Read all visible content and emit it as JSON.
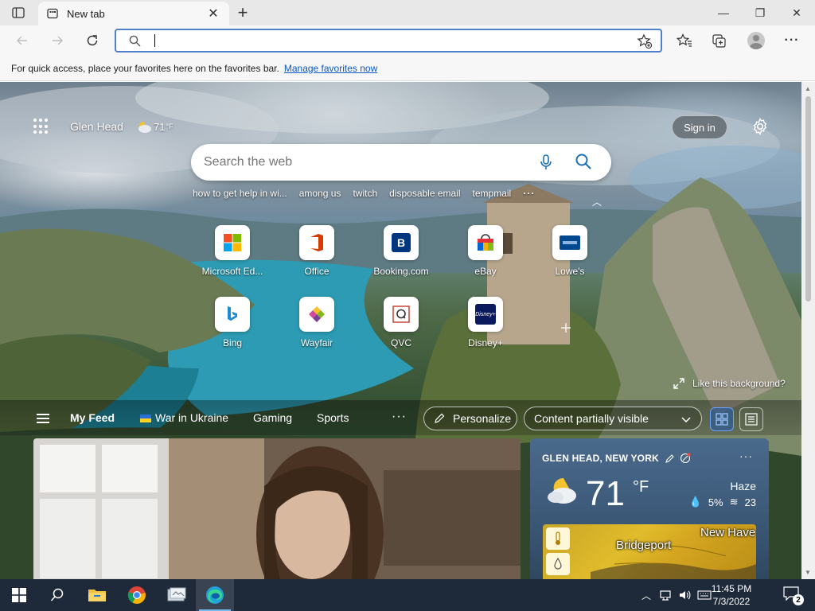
{
  "browser": {
    "tab": {
      "title": "New tab",
      "close_glyph": "✕"
    },
    "new_tab_glyph": "+",
    "window_controls": {
      "minimize": "—",
      "maximize": "❐",
      "close": "✕"
    },
    "address": {
      "value": "",
      "placeholder": ""
    },
    "favorites_bar": {
      "message": "For quick access, place your favorites here on the favorites bar.",
      "link": "Manage favorites now"
    }
  },
  "newtab": {
    "location": "Glen Head",
    "weather_mini": {
      "temp": "71",
      "unit": "°F"
    },
    "sign_in": "Sign in",
    "search": {
      "placeholder": "Search the web"
    },
    "trending": [
      "how to get help in wi...",
      "among us",
      "twitch",
      "disposable email",
      "tempmail"
    ],
    "trending_more": "···",
    "quick_links": [
      {
        "label": "Microsoft Ed...",
        "icon": "microsoft-icon"
      },
      {
        "label": "Office",
        "icon": "office-icon"
      },
      {
        "label": "Booking.com",
        "icon": "booking-icon"
      },
      {
        "label": "eBay",
        "icon": "ebay-icon"
      },
      {
        "label": "Lowe's",
        "icon": "lowes-icon"
      },
      {
        "label": "Bing",
        "icon": "bing-icon"
      },
      {
        "label": "Wayfair",
        "icon": "wayfair-icon"
      },
      {
        "label": "QVC",
        "icon": "qvc-icon"
      },
      {
        "label": "Disney+",
        "icon": "disney-plus-icon"
      }
    ],
    "add_site_glyph": "+",
    "like_background": "Like this background?",
    "feed": {
      "tabs": [
        "My Feed",
        "War in Ukraine",
        "Gaming",
        "Sports"
      ],
      "more": "···",
      "personalize": "Personalize",
      "content_visibility": "Content partially visible"
    },
    "weather_card": {
      "location": "GLEN HEAD, NEW YORK",
      "more": "···",
      "temp": "71",
      "unit": "°F",
      "condition": "Haze",
      "precip": "5%",
      "wind": "23",
      "map_cities": [
        "Bridgeport",
        "New Have"
      ]
    }
  },
  "taskbar": {
    "time": "11:45 PM",
    "date": "7/3/2022",
    "notifications": "2"
  },
  "colors": {
    "accent": "#0b57c4",
    "omnibox_border": "#4f7fc8",
    "taskbar": "#1e2a3a"
  }
}
